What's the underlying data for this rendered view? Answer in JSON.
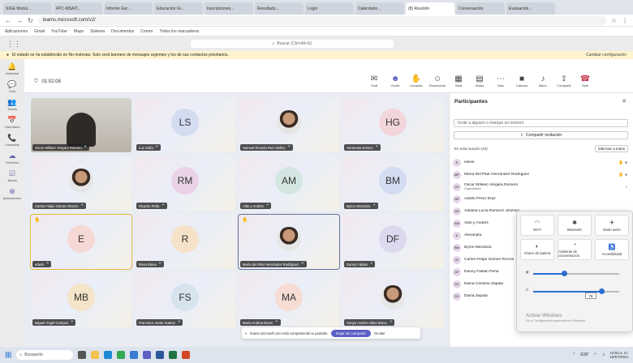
{
  "browser": {
    "tabs": [
      "SIGE Modul...",
      "FPC-MSAIT...",
      "Informe Esc...",
      "Educación Gr...",
      "Inscripciones...",
      "Resultado...",
      "Login",
      "Calendario...",
      "(8) Reunión",
      "Conversación",
      "Evaluación..."
    ],
    "url": "teams.microsoft.com/v2/",
    "bookmarks": [
      "Aplicaciones",
      "Gmail",
      "YouTube",
      "Maps",
      "Sistema",
      "Documentos",
      "Correo",
      "Todos los marcadores"
    ]
  },
  "teams": {
    "search_placeholder": "Buscar (Ctrl+Alt+E)",
    "banner_text": "El estado se ha establecido en No molestar. Solo verá banners de mensajes urgentes y los de sus contactos prioritarios.",
    "banner_action": "Cambiar configuración",
    "rail": [
      "Actividad",
      "Chat",
      "Teams",
      "Calendario",
      "Llamadas",
      "OneDrive",
      "Tareas",
      "Aplicaciones"
    ]
  },
  "meeting": {
    "timer": "01:02:08",
    "tools": [
      {
        "label": "Chat",
        "glyph": "✉"
      },
      {
        "label": "Gente",
        "glyph": "☻"
      },
      {
        "label": "Levantar",
        "glyph": "✋"
      },
      {
        "label": "Reaccionar",
        "glyph": "☺"
      },
      {
        "label": "Vista",
        "glyph": "▦"
      },
      {
        "label": "Notas",
        "glyph": "▤"
      },
      {
        "label": "Más",
        "glyph": "⋯"
      },
      {
        "label": "Cámara",
        "glyph": "■"
      },
      {
        "label": "Micro",
        "glyph": "♪"
      },
      {
        "label": "Compartir",
        "glyph": "⇪"
      },
      {
        "label": "Salir",
        "glyph": "☎"
      }
    ]
  },
  "grid": [
    {
      "type": "video",
      "name": "Oscar William Vergara Romero"
    },
    {
      "type": "initials",
      "initials": "LS",
      "name": "Luz Sofía",
      "color": "#d3dcf0"
    },
    {
      "type": "photo",
      "name": "Samuel Ricardo Ruiz Núñez"
    },
    {
      "type": "initials",
      "initials": "HG",
      "name": "Hortensia Gómez",
      "color": "#f3d6dc"
    },
    {
      "type": "photo",
      "name": "Carlos Felipe Gómez Rincón"
    },
    {
      "type": "initials",
      "initials": "RM",
      "name": "Ricardo Peña",
      "color": "#ead3e8"
    },
    {
      "type": "initials",
      "initials": "AM",
      "name": "Aldo y Andrés",
      "color": "#d3e6e2"
    },
    {
      "type": "initials",
      "initials": "BM",
      "name": "Byron Mendoza",
      "color": "#d3dcf0"
    },
    {
      "type": "initials",
      "initials": "E",
      "name": "edwin",
      "color": "#f6d9d5",
      "selected": true,
      "hand": true
    },
    {
      "type": "initials",
      "initials": "R",
      "name": "Rosa Elena",
      "color": "#f5e2c8"
    },
    {
      "type": "photo",
      "name": "María del Pilar Hernández Rodríguez",
      "selected2": true,
      "hand": true
    },
    {
      "type": "initials",
      "initials": "DF",
      "name": "Danny Fabián",
      "color": "#dcd8ee"
    },
    {
      "type": "initials",
      "initials": "MB",
      "name": "Miguel Ángel Campos",
      "color": "#f4e4c8"
    },
    {
      "type": "initials",
      "initials": "FS",
      "name": "Francisco Javier Suárez",
      "color": "#d6e4ee"
    },
    {
      "type": "initials",
      "initials": "MA",
      "name": "María Andrea Bravo",
      "color": "#f6dcd3"
    },
    {
      "type": "photo",
      "name": "Sergio Andrés Aldaz Bravo"
    }
  ],
  "panel": {
    "title": "Participantes",
    "invite_placeholder": "Invite a alguien o marque un número",
    "share_invite": "Compartir invitación",
    "section": "En esta reunión (23)",
    "mute_all": "Silenciar a todos",
    "people": [
      {
        "initials": "E",
        "name": "edwin",
        "end": "✋ ●"
      },
      {
        "initials": "MP",
        "name": "María Del Pilar Hernández Rodríguez",
        "end": "✋ ●"
      },
      {
        "initials": "OV",
        "name": "Oscar William Vergara Romero",
        "sub": "Organizador",
        "end": "♪"
      },
      {
        "initials": "AP",
        "name": "Adolfo Pérez Díaz",
        "end": ""
      },
      {
        "initials": "AR",
        "name": "Adriana Lucía Ramírez Jiménez",
        "end": ""
      },
      {
        "initials": "AM",
        "name": "Aldo y Andrés",
        "end": ""
      },
      {
        "initials": "A",
        "name": "Alexandra",
        "end": ""
      },
      {
        "initials": "BM",
        "name": "Byron Mendoza",
        "end": ""
      },
      {
        "initials": "CF",
        "name": "Carlos Felipe Gómez Rincón",
        "end": ""
      },
      {
        "initials": "DF",
        "name": "Danny Fabián Peña",
        "end": ""
      },
      {
        "initials": "DC",
        "name": "Diana Carolina Zapata",
        "end": ""
      },
      {
        "initials": "DZ",
        "name": "Diana Zapata",
        "end": ""
      }
    ]
  },
  "quick_settings": {
    "tiles_row1": [
      {
        "label": "Wi-Fi",
        "glyph": "◠"
      },
      {
        "label": "Bluetooth",
        "glyph": "✱"
      },
      {
        "label": "Modo avión",
        "glyph": "✈"
      }
    ],
    "tiles_row2": [
      {
        "label": "Ahorro de batería",
        "glyph": "◐"
      },
      {
        "label": "Asistente de concentración",
        "glyph": "◔"
      },
      {
        "label": "Accesibilidad",
        "glyph": "♿"
      }
    ],
    "brightness_icon": "☀",
    "volume_icon": "♫",
    "brightness_level": 0.35,
    "volume_level": 0.78,
    "tooltip": "78"
  },
  "activate_windows": {
    "title": "Activar Windows",
    "sub": "Ve a Configuración para activar Windows."
  },
  "share_notice": {
    "text": "teams.microsoft.com está compartiendo tu pantalla.",
    "button": "Dejar de compartir",
    "hide": "Ocultar"
  },
  "taskbar": {
    "search": "Búsqueda",
    "time": "10:52 a. m.",
    "date": "18/07/2024",
    "lang": "ESP"
  }
}
